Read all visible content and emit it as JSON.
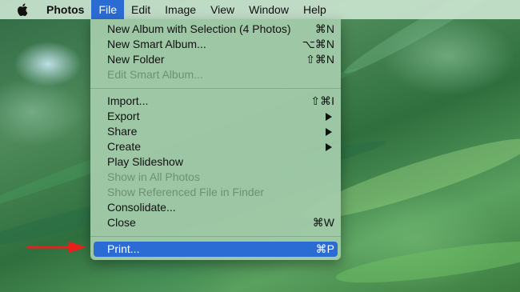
{
  "menubar": {
    "apple_icon": "apple-logo-icon",
    "items": [
      "Photos",
      "File",
      "Edit",
      "Image",
      "View",
      "Window",
      "Help"
    ],
    "active_index": 1
  },
  "file_menu": {
    "items": [
      {
        "label": "New Album with Selection (4 Photos)",
        "shortcut": "⌘N"
      },
      {
        "label": "New Smart Album...",
        "shortcut": "⌥⌘N"
      },
      {
        "label": "New Folder",
        "shortcut": "⇧⌘N"
      },
      {
        "label": "Edit Smart Album..."
      },
      {
        "label": "Import...",
        "shortcut": "⇧⌘I"
      },
      {
        "label": "Export"
      },
      {
        "label": "Share"
      },
      {
        "label": "Create"
      },
      {
        "label": "Play Slideshow"
      },
      {
        "label": "Show in All Photos"
      },
      {
        "label": "Show Referenced File in Finder"
      },
      {
        "label": "Consolidate..."
      },
      {
        "label": "Close",
        "shortcut": "⌘W"
      },
      {
        "label": "Print...",
        "shortcut": "⌘P"
      }
    ]
  },
  "colors": {
    "highlight": "#2b6cd4",
    "callout_arrow": "#e8201c"
  }
}
